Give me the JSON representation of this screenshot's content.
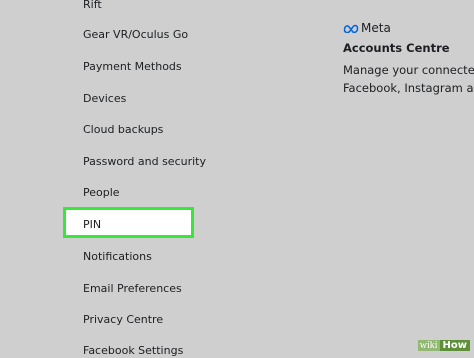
{
  "sidebar": {
    "items": [
      {
        "label": "Rift"
      },
      {
        "label": "Gear VR/Oculus Go"
      },
      {
        "label": "Payment Methods"
      },
      {
        "label": "Devices"
      },
      {
        "label": "Cloud backups"
      },
      {
        "label": "Password and security"
      },
      {
        "label": "People"
      },
      {
        "label": "PIN",
        "highlighted": true
      },
      {
        "label": "Notifications"
      },
      {
        "label": "Email Preferences"
      },
      {
        "label": "Privacy Centre"
      },
      {
        "label": "Facebook Settings"
      }
    ]
  },
  "accounts_panel": {
    "brand": "Meta",
    "title": "Accounts Centre",
    "line1": "Manage your connecte",
    "line2": "Facebook, Instagram a"
  },
  "watermark": {
    "wiki": "wiki",
    "how": "How"
  },
  "colors": {
    "highlight_border": "#39e639",
    "background": "#cfcfcf",
    "meta_blue": "#0064e0"
  },
  "icons": {
    "meta_logo": "meta-infinity-icon"
  }
}
